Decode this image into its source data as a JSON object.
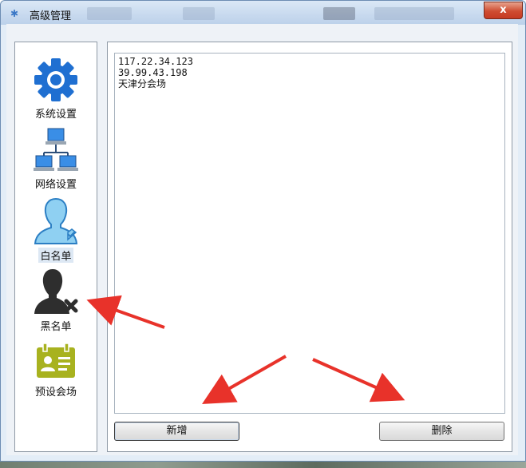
{
  "window": {
    "title": "高级管理",
    "close_glyph": "x"
  },
  "sidebar": {
    "items": [
      {
        "label": "系统设置",
        "icon": "gear-icon",
        "selected": false
      },
      {
        "label": "网络设置",
        "icon": "network-icon",
        "selected": false
      },
      {
        "label": "白名单",
        "icon": "whitelist-user-icon",
        "selected": true
      },
      {
        "label": "黑名单",
        "icon": "blacklist-user-icon",
        "selected": false
      },
      {
        "label": "预设会场",
        "icon": "id-card-icon",
        "selected": false
      }
    ]
  },
  "list": {
    "items": [
      "117.22.34.123",
      "39.99.43.198",
      "天津分会场"
    ]
  },
  "buttons": {
    "add_label": "新增",
    "delete_label": "删除"
  },
  "colors": {
    "accent_blue": "#1f6fd1",
    "annotation_red": "#e8322a",
    "card_green": "#a8b21f"
  }
}
